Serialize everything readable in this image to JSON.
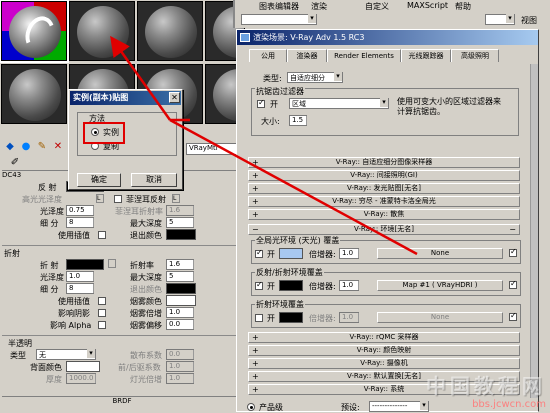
{
  "material_editor": {
    "slots": [
      "slot-1",
      "slot-2",
      "slot-3",
      "slot-4",
      "slot-5",
      "slot-6"
    ],
    "rollout_dc": "DC43",
    "material_type": "RayMtl",
    "reflection": {
      "section": "",
      "label": "反 射",
      "hilight_gloss": "高光光泽度",
      "hilight_gloss_lock": "L",
      "fresnel_label": "菲涅耳反射",
      "fresnel_lock": "L",
      "gloss_label": "光泽度",
      "gloss_value": "0.75",
      "fresnel_ior_label": "菲涅耳折射率",
      "fresnel_ior_value": "1.6",
      "subdivs_label": "细 分",
      "subdivs_value": "8",
      "max_depth_label": "最大深度",
      "max_depth_value": "5",
      "interp_label": "使用插值",
      "exit_color_label": "退出颜色"
    },
    "refraction": {
      "section": "折射",
      "label": "折 射",
      "ior_label": "折射率",
      "ior_value": "1.6",
      "gloss_label": "光泽度",
      "gloss_value": "1.0",
      "max_depth_label": "最大深度",
      "max_depth_value": "5",
      "subdivs_label": "细 分",
      "subdivs_value": "8",
      "exit_color_label": "退出颜色",
      "interp_label": "使用插值",
      "fog_color_label": "烟雾颜色",
      "shadows_label": "影响阴影",
      "fog_mult_label": "烟雾倍增",
      "fog_mult_value": "1.0",
      "alpha_label": "影响 Alpha",
      "fog_bias_label": "烟雾偏移",
      "fog_bias_value": "0.0"
    },
    "translucency": {
      "section": "半透明",
      "type_label": "类型",
      "type_value": "无",
      "scatter_label": "散布系数",
      "scatter_value": "0.0",
      "back_color_label": "背面颜色",
      "fwd_bck_label": "前/后驱系数",
      "fwd_bck_value": "1.0",
      "thickness_label": "厚度",
      "thickness_value": "1000.0",
      "light_mult_label": "灯光倍增",
      "light_mult_value": "1.0"
    },
    "brdf": "BRDF"
  },
  "instance_dialog": {
    "title": "实例(副本)贴图",
    "group_label": "方法",
    "option_instance": "实例",
    "option_copy": "复制",
    "ok": "确定",
    "cancel": "取消"
  },
  "top_strip": {
    "menu": [
      "图表编辑器",
      "渲染",
      "自定义",
      "MAXScript",
      "帮助"
    ],
    "view_label": "视图"
  },
  "render_dialog": {
    "title": "渲染场景: V-Ray Adv 1.5 RC3",
    "tabs": [
      "公用",
      "渲染器",
      "Render Elements",
      "光线跟踪器",
      "高级照明"
    ],
    "type_label": "类型:",
    "type_value": "自适应细分",
    "aa_filter_label": "抗锯齿过滤器",
    "on_label": "开",
    "filter_value": "区域",
    "filter_desc": "使用可变大小的区域过滤器来计算抗锯齿。",
    "size_label": "大小:",
    "size_value": "1.5",
    "rollouts_top": [
      "V-Ray:: 自适应细分图像采样器",
      "V-Ray:: 间接照明(GI)",
      "V-Ray:: 发光贴图[无名]",
      "V-Ray:: 穷尽 - 准蒙特卡洛全局光",
      "V-Ray:: 散焦"
    ],
    "env_rollout": "V-Ray:: 环境[无名]",
    "gi_env_label": "全局光环境 (天光) 覆盖",
    "gi_on": "开",
    "gi_mult_label": "倍增器:",
    "gi_mult_value": "1.0",
    "gi_map": "None",
    "refl_env_label": "反射/折射环境覆盖",
    "refl_on": "开",
    "refl_mult_label": "倍增器:",
    "refl_mult_value": "1.0",
    "refl_map": "Map #1  ( VRayHDRI )",
    "refr_env_label": "折射环境覆盖",
    "refr_on": "开",
    "refr_mult_label": "倍增器:",
    "refr_mult_value": "1.0",
    "refr_map": "None",
    "rollouts_bottom": [
      "V-Ray:: rQMC 采样器",
      "V-Ray:: 颜色映射",
      "V-Ray:: 摄像机",
      "V-Ray:: 默认置换[无名]",
      "V-Ray:: 系统"
    ],
    "product_label": "产品级",
    "preset_label": "预设:",
    "preset_value": "--------------"
  },
  "watermark": {
    "line1": "中国教程网",
    "line2": "bbs.jcwcn.com"
  },
  "colors": {
    "highlight_red": "#e00000",
    "title_blue": "#0a246a",
    "panel_gray": "#d4d0c8"
  }
}
